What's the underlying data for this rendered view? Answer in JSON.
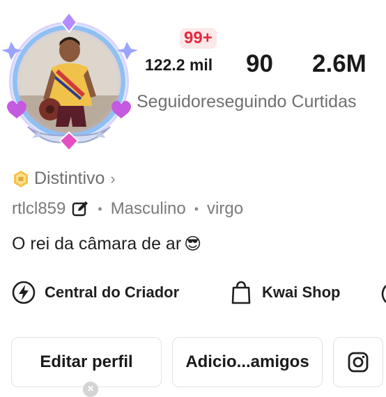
{
  "badge": {
    "count": "99+"
  },
  "stats": {
    "followers_value": "122.2 mil",
    "following_value": "90",
    "likes_value": "2.6M",
    "labels_text": "Seguidoreseguindo Curtidas"
  },
  "profile": {
    "distintivo_label": "Distintivo",
    "username": "rtlcl859",
    "gender": "Masculino",
    "sign": "virgo",
    "bio": "O rei da câmara de ar",
    "bio_emoji": "😎"
  },
  "shortcuts": {
    "central_label": "Central do Criador",
    "kwai_label": "Kwai Shop"
  },
  "buttons": {
    "edit_label": "Editar perfil",
    "add_label": "Adicio...amigos"
  },
  "colors": {
    "badge_red": "#e5293e",
    "frame_blue": "#7fb4f0",
    "frame_purple": "#a55be0",
    "gold": "#e0a93a"
  },
  "icons": {
    "badge": "coin-badge-icon",
    "edit": "edit-icon",
    "central": "lightning-icon",
    "kwai": "shopping-bag-icon",
    "instagram": "instagram-icon"
  }
}
